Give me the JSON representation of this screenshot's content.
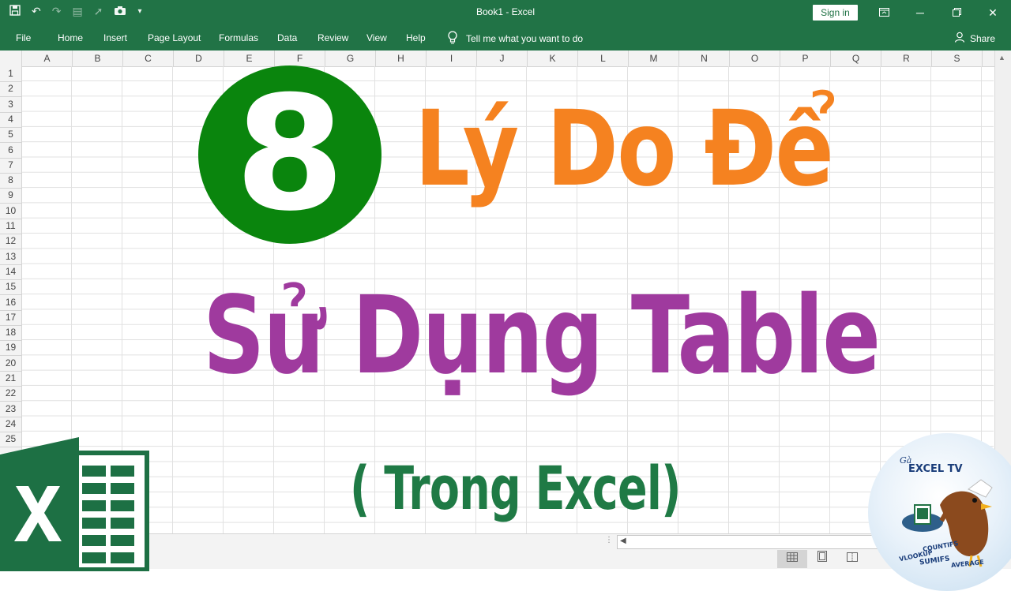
{
  "titlebar": {
    "title": "Book1  -  Excel",
    "sign_in": "Sign in",
    "icons": [
      "save-icon",
      "undo-icon",
      "redo-icon",
      "layout-icon",
      "pointer-icon",
      "camera-icon",
      "customize-icon"
    ]
  },
  "ribbon": {
    "tabs": [
      "File",
      "Home",
      "Insert",
      "Page Layout",
      "Formulas",
      "Data",
      "Review",
      "View",
      "Help"
    ],
    "tell_me": "Tell me what you want to do",
    "share": "Share"
  },
  "grid": {
    "columns": [
      "A",
      "B",
      "C",
      "D",
      "E",
      "F",
      "G",
      "H",
      "I",
      "J",
      "K",
      "L",
      "M",
      "N",
      "O",
      "P",
      "Q",
      "R",
      "S"
    ],
    "rows": [
      "1",
      "2",
      "3",
      "4",
      "5",
      "6",
      "7",
      "8",
      "9",
      "10",
      "11",
      "12",
      "13",
      "14",
      "15",
      "16",
      "17",
      "18",
      "19",
      "20",
      "21",
      "22",
      "23",
      "24",
      "25"
    ]
  },
  "thumbnail": {
    "number": "8",
    "line1": "Lý Do Để",
    "line2": "Sử Dụng Table",
    "line3": "( Trong Excel)",
    "colors": {
      "circle": "#0a850d",
      "line1": "#f58220",
      "line2": "#9f3a9e",
      "line3": "#1f7a45",
      "excel_green": "#217346"
    }
  },
  "badge": {
    "sub": "Gà",
    "title": "EXCEL TV",
    "tags": [
      "VLOOKUP",
      "COUNTIFS",
      "SUMIFS",
      "AVERAGE"
    ]
  }
}
